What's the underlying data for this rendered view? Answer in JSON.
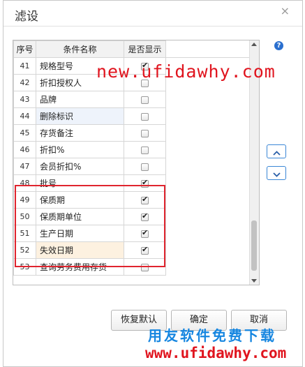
{
  "dialog": {
    "title": "滤设",
    "close_glyph": "×"
  },
  "table": {
    "headers": [
      "序号",
      "条件名称",
      "是否显示"
    ],
    "rows": [
      {
        "no": "41",
        "name": "规格型号",
        "checked": true
      },
      {
        "no": "42",
        "name": "折扣授权人",
        "checked": false
      },
      {
        "no": "43",
        "name": "品牌",
        "checked": false
      },
      {
        "no": "44",
        "name": "删除标识",
        "checked": false
      },
      {
        "no": "45",
        "name": "存货备注",
        "checked": false
      },
      {
        "no": "46",
        "name": "折扣%",
        "checked": false
      },
      {
        "no": "47",
        "name": "会员折扣%",
        "checked": false
      },
      {
        "no": "48",
        "name": "批号",
        "checked": true
      },
      {
        "no": "49",
        "name": "保质期",
        "checked": true
      },
      {
        "no": "50",
        "name": "保质期单位",
        "checked": true
      },
      {
        "no": "51",
        "name": "生产日期",
        "checked": true
      },
      {
        "no": "52",
        "name": "失效日期",
        "checked": true
      },
      {
        "no": "53",
        "name": "查询劳务费用存货",
        "checked": false
      }
    ]
  },
  "help_glyph": "?",
  "buttons": {
    "restore": "恢复默认",
    "ok": "确定",
    "cancel": "取消"
  },
  "watermarks": {
    "top": "new.ufidawhy.com",
    "bottom_cn": "用友软件免费下载",
    "bottom_url": "www.ufidawhy.com"
  },
  "colors": {
    "highlight_border": "#e0242e",
    "watermark_red": "#e0141e",
    "watermark_blue": "#1686e0",
    "accent_blue": "#3a86d6"
  }
}
